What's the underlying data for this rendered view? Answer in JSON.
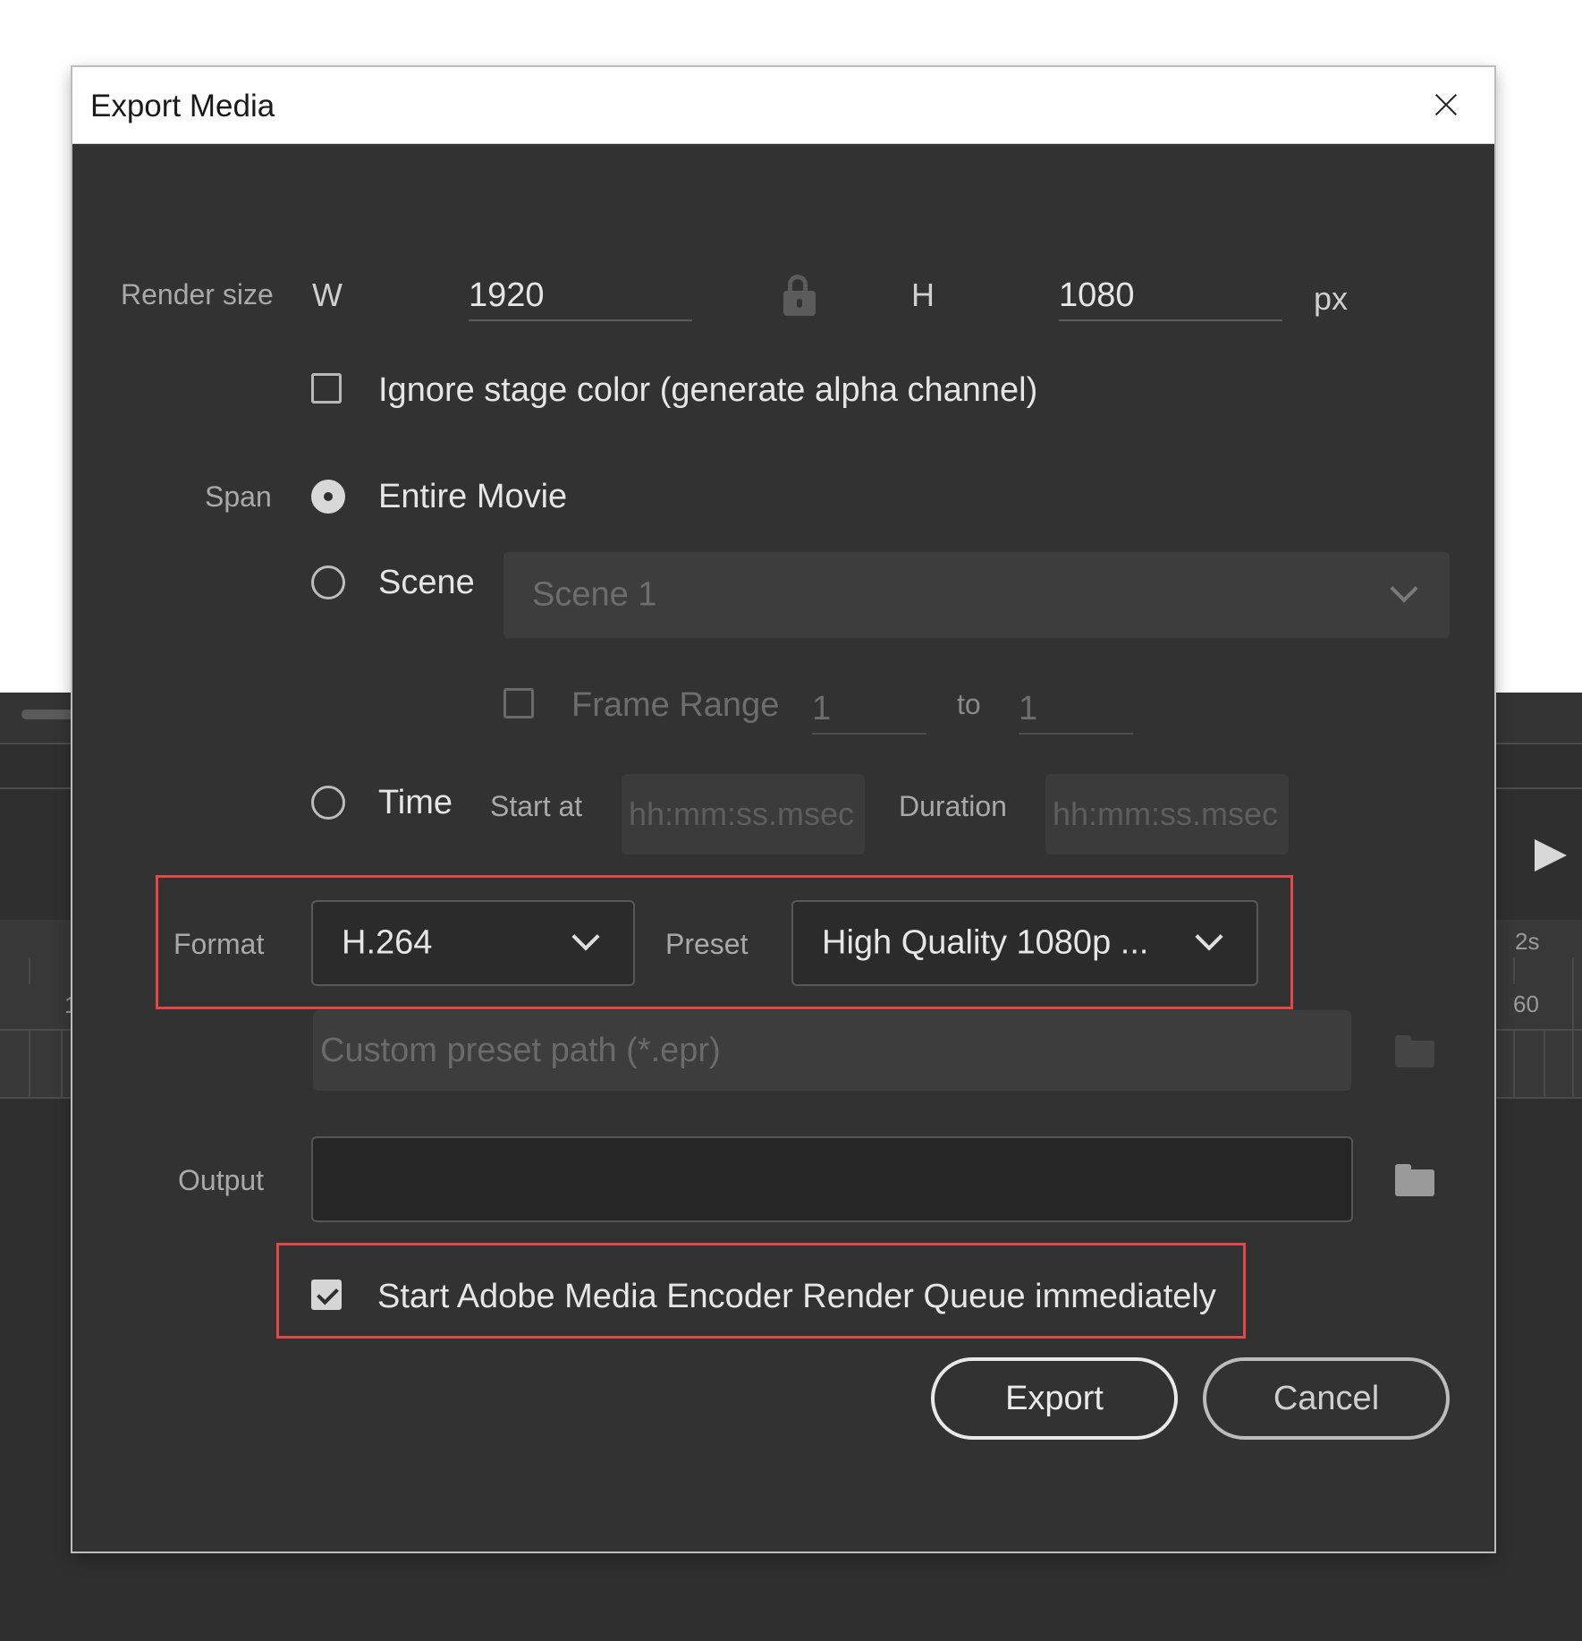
{
  "background": {
    "timeline_label_top": "2s",
    "timeline_label_bottom": "60",
    "timeline_label_left": "1"
  },
  "dialog": {
    "title": "Export Media",
    "render_size": {
      "label": "Render size",
      "w_label": "W",
      "w_value": "1920",
      "h_label": "H",
      "h_value": "1080",
      "unit": "px"
    },
    "ignore_stage_color": {
      "label": "Ignore stage color (generate alpha channel)",
      "checked": false
    },
    "span": {
      "label": "Span",
      "entire_movie": "Entire Movie",
      "scene": "Scene",
      "scene_select_value": "Scene 1",
      "frame_range_label": "Frame Range",
      "frame_from": "1",
      "to_label": "to",
      "frame_to": "1",
      "time": "Time",
      "start_at_label": "Start at",
      "start_at_placeholder": "hh:mm:ss.msec",
      "duration_label": "Duration",
      "duration_placeholder": "hh:mm:ss.msec",
      "selected": "Entire Movie"
    },
    "format": {
      "label": "Format",
      "value": "H.264"
    },
    "preset": {
      "label": "Preset",
      "value": "High Quality 1080p ..."
    },
    "custom_preset_placeholder": "Custom preset path (*.epr)",
    "output": {
      "label": "Output",
      "value": ""
    },
    "start_queue": {
      "label": "Start Adobe Media Encoder Render Queue immediately",
      "checked": true
    },
    "buttons": {
      "export": "Export",
      "cancel": "Cancel"
    },
    "colors": {
      "highlight": "#e0484a",
      "dialog_bg": "#323232"
    }
  }
}
